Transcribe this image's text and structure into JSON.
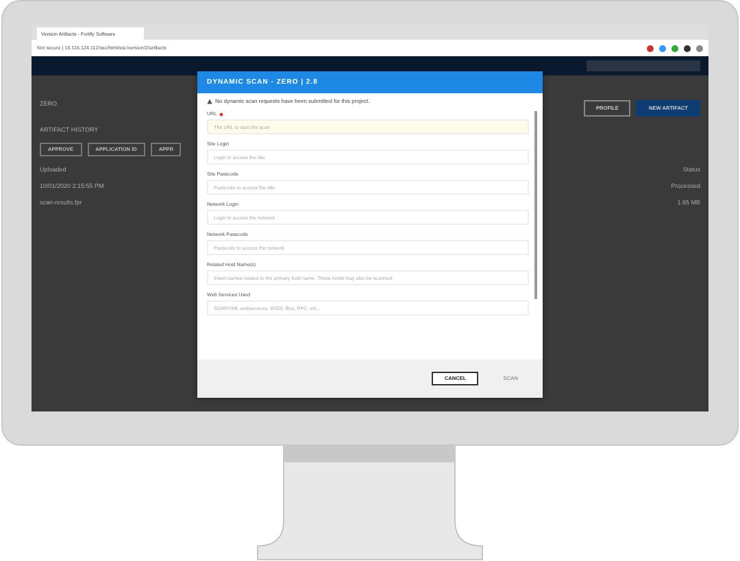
{
  "browser": {
    "tab_title": "Version Artifacts - Fortify Software",
    "url": "Not secure | 15.116.124.112/ssc/html/ssc/version/2/artifacts"
  },
  "app": {
    "project": "ZERO",
    "section": "ARTIFACT HISTORY",
    "actions": [
      "APPROVE",
      "APPLICATION ID",
      "APPR"
    ],
    "right_actions": [
      {
        "label": "PROFILE",
        "kind": "outline"
      },
      {
        "label": "NEW ARTIFACT",
        "kind": "primary"
      }
    ],
    "rows": [
      {
        "left": "Uploaded",
        "right": "Status"
      },
      {
        "left": "10/01/2020 2:15:55 PM",
        "right": "Processed"
      },
      {
        "left": "scan-results.fpr",
        "right": "1.65 MB"
      }
    ]
  },
  "dialog": {
    "title": "DYNAMIC SCAN - ZERO | 2.8",
    "notice": "No dynamic scan requests have been submitted for this project.",
    "fields": [
      {
        "label": "URL",
        "placeholder": "The URL to start the scan",
        "required": true
      },
      {
        "label": "Site Login",
        "placeholder": "Login to access the site",
        "required": false
      },
      {
        "label": "Site Passcode",
        "placeholder": "Passcode to access the site",
        "required": false
      },
      {
        "label": "Network Login",
        "placeholder": "Login to access the network",
        "required": false
      },
      {
        "label": "Network Passcode",
        "placeholder": "Passcode to access the network",
        "required": false
      },
      {
        "label": "Related Host Name(s)",
        "placeholder": "Insert names related to the primary host name. These hosts may also be scanned.",
        "required": false
      },
      {
        "label": "Web Services Used",
        "placeholder": "SOAP/XML webservices, WSDL files, RPC, etc...",
        "required": false
      }
    ],
    "buttons": [
      {
        "label": "CANCEL",
        "disabled": false
      },
      {
        "label": "SCAN",
        "disabled": true
      }
    ]
  }
}
